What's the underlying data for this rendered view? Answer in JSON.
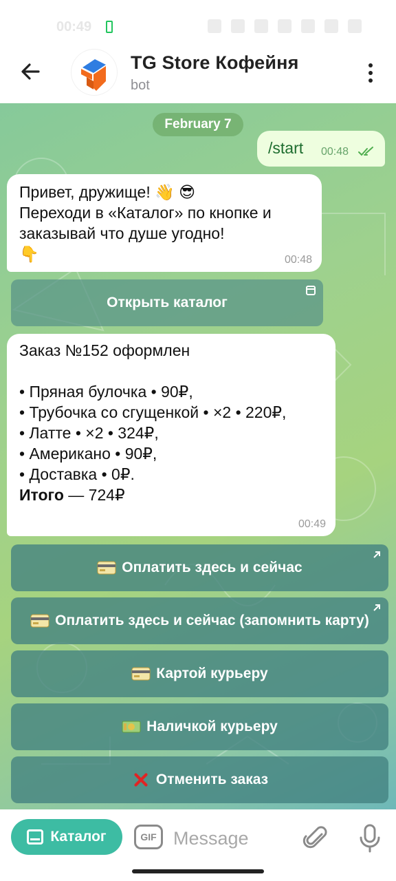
{
  "status_bar": {
    "time": "00:49"
  },
  "header": {
    "title": "TG Store Кофейня",
    "subtitle": "bot"
  },
  "chat": {
    "date_pill": "February 7",
    "outgoing": {
      "text": "/start",
      "time": "00:48"
    },
    "greeting": {
      "text": "Привет, дружище! 👋 😎\nПереходи в «Каталог» по кнопке и\nзаказывай что душе угодно!\n👇",
      "time": "00:48"
    },
    "open_catalog_button": "Открыть каталог",
    "order": {
      "text": "Заказ №152 оформлен\n\n• Пряная булочка • 90₽,\n• Трубочка со сгущенкой • ×2 • 220₽,\n• Латте • ×2 • 324₽,\n• Американо • 90₽,\n• Доставка • 0₽.\n",
      "total_label": "Итого",
      "total_value": " — 724₽",
      "time": "00:49"
    },
    "keyboard": [
      {
        "label": "Оплатить здесь и сейчас",
        "icon": "credit-card-emoji"
      },
      {
        "label": "Оплатить здесь и сейчас (запомнить карту)",
        "icon": "credit-card-emoji"
      },
      {
        "label": "Картой курьеру",
        "icon": "credit-card-emoji"
      },
      {
        "label": "Наличкой курьеру",
        "icon": "money-emoji"
      },
      {
        "label": "Отменить заказ",
        "icon": "cross-mark-emoji"
      }
    ]
  },
  "input_bar": {
    "catalog_button": "Каталог",
    "gif_label": "GIF",
    "placeholder": "Message"
  },
  "colors": {
    "accent": "#3dbca3",
    "outgoing_bubble": "#eefedf",
    "keyboard_button": "#428280"
  }
}
